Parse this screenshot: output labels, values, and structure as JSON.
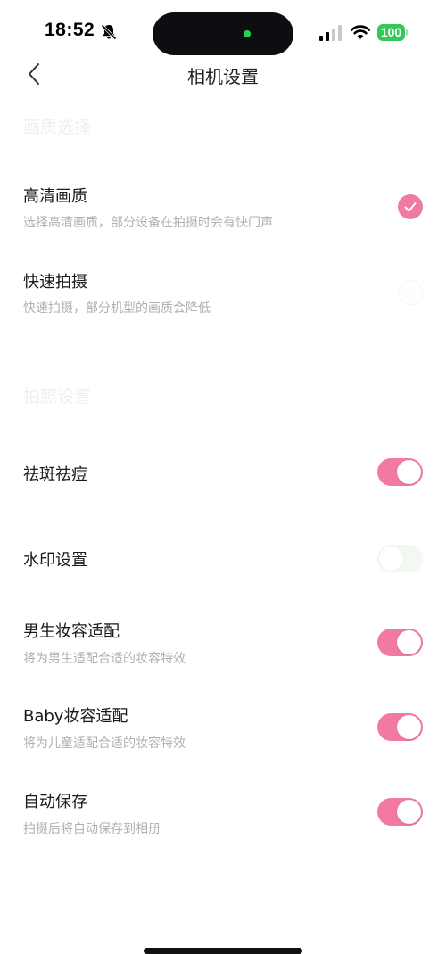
{
  "status_bar": {
    "time": "18:52",
    "battery": "100",
    "battery_color": "#34c759"
  },
  "nav": {
    "title": "相机设置",
    "back_icon": "chevron-left-icon"
  },
  "sections": [
    {
      "header": "画质选择",
      "items": [
        {
          "title": "高清画质",
          "subtitle": "选择高清画质，部分设备在拍摄时会有快门声",
          "control": "check",
          "selected": true
        },
        {
          "title": "快速拍摄",
          "subtitle": "快速拍摄，部分机型的画质会降低",
          "control": "check",
          "selected": false
        }
      ]
    },
    {
      "header": "拍照设置",
      "items": [
        {
          "title": "祛斑祛痘",
          "subtitle": "",
          "control": "toggle",
          "on": true
        },
        {
          "title": "水印设置",
          "subtitle": "",
          "control": "toggle",
          "on": false
        },
        {
          "title": "男生妆容适配",
          "subtitle": "将为男生适配合适的妆容特效",
          "control": "toggle",
          "on": true
        },
        {
          "title": "Baby妆容适配",
          "subtitle": "将为儿童适配合适的妆容特效",
          "control": "toggle",
          "on": true
        },
        {
          "title": "自动保存",
          "subtitle": "拍摄后将自动保存到相册",
          "control": "toggle",
          "on": true
        }
      ]
    }
  ],
  "colors": {
    "accent": "#f27aa2",
    "section_header": "#eaf3e8",
    "subtitle": "#b0b0b0"
  }
}
